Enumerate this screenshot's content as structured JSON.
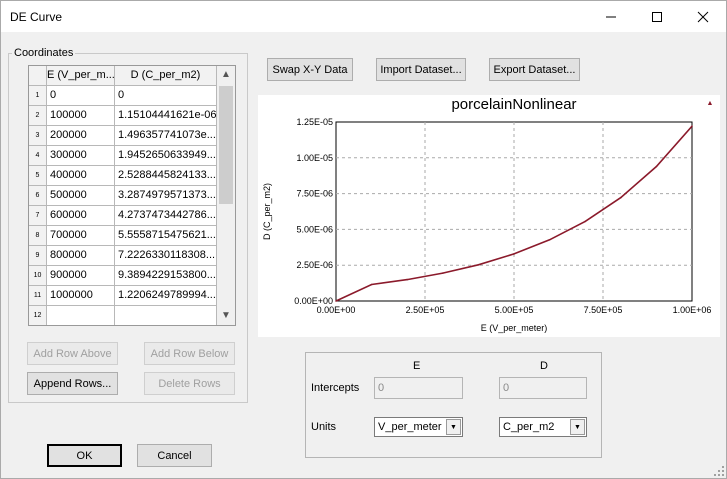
{
  "window": {
    "title": "DE Curve"
  },
  "icons": {
    "minimize": "minimize-icon",
    "maximize": "maximize-icon",
    "close": "close-icon"
  },
  "coordinates": {
    "legend": "Coordinates",
    "columns": [
      "E (V_per_m...",
      "D (C_per_m2)"
    ],
    "rows": [
      {
        "n": "1",
        "e": "0",
        "d": "0"
      },
      {
        "n": "2",
        "e": "100000",
        "d": "1.15104441621e-06"
      },
      {
        "n": "3",
        "e": "200000",
        "d": "1.496357741073e..."
      },
      {
        "n": "4",
        "e": "300000",
        "d": "1.9452650633949..."
      },
      {
        "n": "5",
        "e": "400000",
        "d": "2.5288445824133..."
      },
      {
        "n": "6",
        "e": "500000",
        "d": "3.2874979571373..."
      },
      {
        "n": "7",
        "e": "600000",
        "d": "4.2737473442786..."
      },
      {
        "n": "8",
        "e": "700000",
        "d": "5.5558715475621..."
      },
      {
        "n": "9",
        "e": "800000",
        "d": "7.2226330118308..."
      },
      {
        "n": "10",
        "e": "900000",
        "d": "9.3894229153800..."
      },
      {
        "n": "11",
        "e": "1000000",
        "d": "1.2206249789994..."
      },
      {
        "n": "12",
        "e": "",
        "d": ""
      }
    ],
    "add_row_above": "Add Row Above",
    "add_row_below": "Add Row Below",
    "append_rows": "Append Rows...",
    "delete_rows": "Delete Rows"
  },
  "toolbar": {
    "swap": "Swap X-Y Data",
    "import": "Import Dataset...",
    "export": "Export Dataset..."
  },
  "chart_data": {
    "type": "line",
    "title": "porcelainNonlinear",
    "xlabel": "E (V_per_meter)",
    "ylabel": "D (C_per_m2)",
    "xlim": [
      0,
      1000000
    ],
    "ylim": [
      0,
      1.25e-05
    ],
    "x_ticks": [
      "0.00E+00",
      "2.50E+05",
      "5.00E+05",
      "7.50E+05",
      "1.00E+06"
    ],
    "y_ticks": [
      "0.00E+00",
      "2.50E-06",
      "5.00E-06",
      "7.50E-06",
      "1.00E-05",
      "1.25E-05"
    ],
    "grid": true,
    "series": [
      {
        "color": "#8b1a2b",
        "x": [
          0,
          100000,
          200000,
          300000,
          400000,
          500000,
          600000,
          700000,
          800000,
          900000,
          1000000
        ],
        "y": [
          0,
          1.15104441621e-06,
          1.496357741073e-06,
          1.9452650633949e-06,
          2.5288445824133e-06,
          3.2874979571373e-06,
          4.2737473442786e-06,
          5.5558715475621e-06,
          7.2226330118308e-06,
          9.38942291538e-06,
          1.2206249789994e-05
        ]
      }
    ],
    "corner_marker": "▲"
  },
  "panel": {
    "col_e": "E",
    "col_d": "D",
    "intercepts_label": "Intercepts",
    "intercept_e": "0",
    "intercept_d": "0",
    "units_label": "Units",
    "units_e": "V_per_meter",
    "units_d": "C_per_m2"
  },
  "footer": {
    "ok": "OK",
    "cancel": "Cancel"
  }
}
